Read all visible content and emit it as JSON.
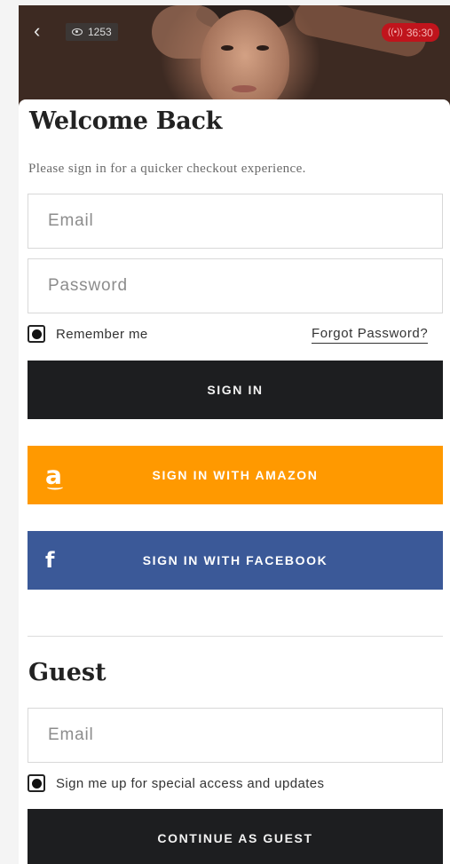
{
  "video": {
    "views": "1253",
    "timer": "36:30"
  },
  "sign_in": {
    "title": "Welcome Back",
    "subtitle": "Please sign in for a quicker checkout experience.",
    "email_placeholder": "Email",
    "password_placeholder": "Password",
    "remember_label": "Remember me",
    "remember_checked": true,
    "forgot_label": "Forgot Password?",
    "sign_in_label": "SIGN IN",
    "amazon_label": "SIGN IN WITH AMAZON",
    "amazon_icon": "a",
    "facebook_label": "SIGN IN WITH FACEBOOK",
    "facebook_icon": "f"
  },
  "guest": {
    "title": "Guest",
    "email_placeholder": "Email",
    "updates_label": "Sign me up for special access and updates",
    "updates_checked": true,
    "continue_label": "CONTINUE AS GUEST"
  },
  "colors": {
    "dark_button": "#1d1e20",
    "amazon": "#ff9900",
    "facebook": "#3b5998",
    "live": "#c0141c"
  }
}
